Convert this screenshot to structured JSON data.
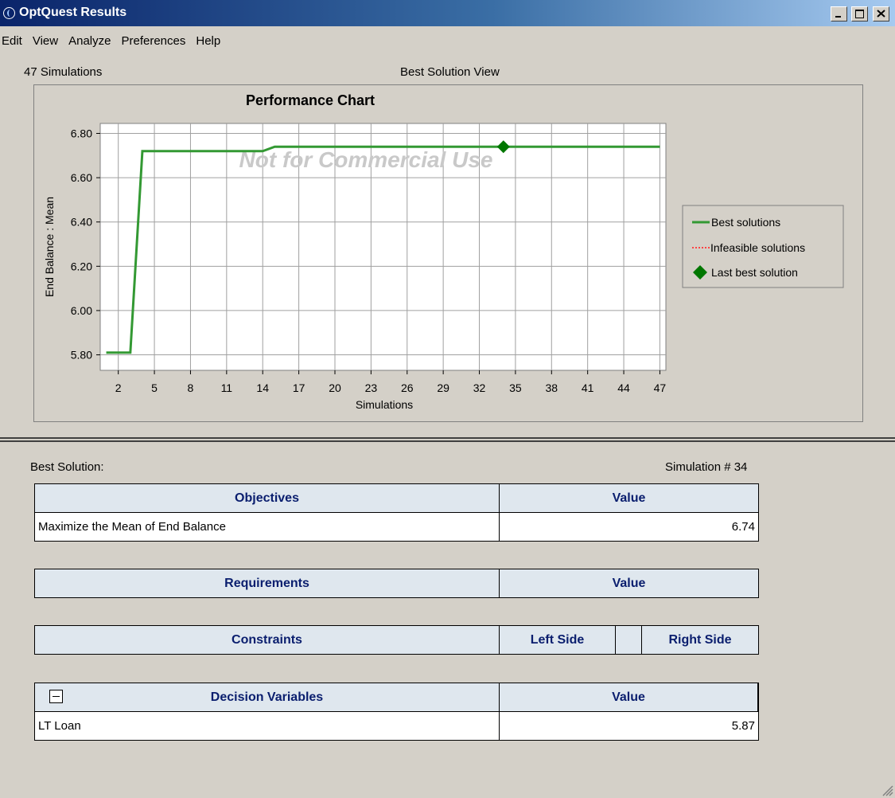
{
  "window": {
    "title": "OptQuest Results"
  },
  "menu": [
    "Edit",
    "View",
    "Analyze",
    "Preferences",
    "Help"
  ],
  "header": {
    "simulations": "47 Simulations",
    "view": "Best Solution View"
  },
  "chart": {
    "title": "Performance Chart",
    "ylabel": "End Balance : Mean",
    "xlabel": "Simulations",
    "watermark": "Not for Commercial Use",
    "legend": [
      "Best solutions",
      "Infeasible solutions",
      "Last best solution"
    ],
    "line_color": "#339933",
    "marker_color": "#007700",
    "infeasible_color": "#ff4444"
  },
  "chart_data": {
    "type": "line",
    "title": "Performance Chart",
    "xlabel": "Simulations",
    "ylabel": "End Balance : Mean",
    "xlim": [
      0.5,
      47.5
    ],
    "ylim": [
      5.73,
      6.845
    ],
    "yticks": [
      5.8,
      6.0,
      6.2,
      6.4,
      6.6,
      6.8
    ],
    "ytick_labels": [
      "5.80",
      "6.00",
      "6.20",
      "6.40",
      "6.60",
      "6.80"
    ],
    "xticks": [
      2,
      5,
      8,
      11,
      14,
      17,
      20,
      23,
      26,
      29,
      32,
      35,
      38,
      41,
      44,
      47
    ],
    "xtick_labels": [
      "2",
      "5",
      "8",
      "11",
      "14",
      "17",
      "20",
      "23",
      "26",
      "29",
      "32",
      "35",
      "38",
      "41",
      "44",
      "47"
    ],
    "grid": true,
    "legend_position": "right",
    "series": [
      {
        "name": "Best solutions",
        "x": [
          1,
          3,
          4,
          14,
          15,
          47
        ],
        "y": [
          5.81,
          5.81,
          6.72,
          6.72,
          6.74,
          6.74
        ]
      },
      {
        "name": "Last best solution",
        "x": [
          34
        ],
        "y": [
          6.74
        ]
      }
    ]
  },
  "best_solution": {
    "label": "Best Solution:",
    "simulation": "Simulation # 34"
  },
  "objectives": {
    "header": "Objectives",
    "value_header": "Value",
    "rows": [
      {
        "name": "Maximize the Mean of End Balance",
        "value": "6.74"
      }
    ]
  },
  "requirements": {
    "header": "Requirements",
    "value_header": "Value"
  },
  "constraints": {
    "header": "Constraints",
    "left_header": "Left Side",
    "right_header": "Right Side"
  },
  "decision_variables": {
    "header": "Decision Variables",
    "value_header": "Value",
    "rows": [
      {
        "name": "LT Loan",
        "value": "5.87"
      }
    ]
  }
}
